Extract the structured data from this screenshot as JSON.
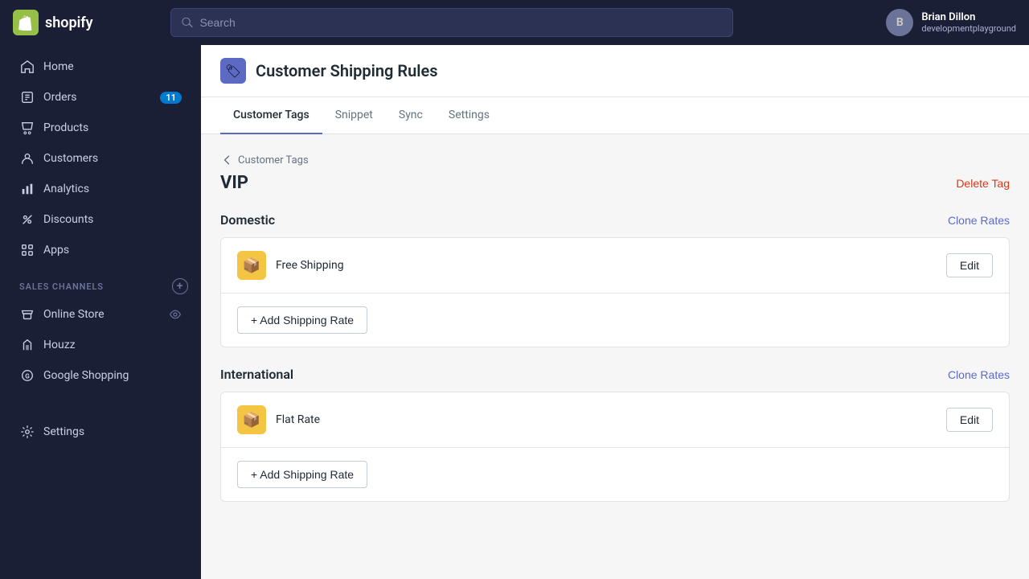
{
  "topnav": {
    "logo_text": "shopify",
    "search_placeholder": "Search"
  },
  "user": {
    "name": "Brian Dillon",
    "sub": "developmentplayground",
    "initials": "B"
  },
  "sidebar": {
    "items": [
      {
        "id": "home",
        "label": "Home",
        "icon": "home-icon",
        "badge": null
      },
      {
        "id": "orders",
        "label": "Orders",
        "icon": "orders-icon",
        "badge": "11"
      },
      {
        "id": "products",
        "label": "Products",
        "icon": "products-icon",
        "badge": null
      },
      {
        "id": "customers",
        "label": "Customers",
        "icon": "customers-icon",
        "badge": null
      },
      {
        "id": "analytics",
        "label": "Analytics",
        "icon": "analytics-icon",
        "badge": null
      },
      {
        "id": "discounts",
        "label": "Discounts",
        "icon": "discounts-icon",
        "badge": null
      },
      {
        "id": "apps",
        "label": "Apps",
        "icon": "apps-icon",
        "badge": null
      }
    ],
    "sales_channels_label": "SALES CHANNELS",
    "sales_channels": [
      {
        "id": "online-store",
        "label": "Online Store",
        "icon": "store-icon",
        "has_eye": true
      },
      {
        "id": "houzz",
        "label": "Houzz",
        "icon": "houzz-icon",
        "has_eye": false
      },
      {
        "id": "google-shopping",
        "label": "Google Shopping",
        "icon": "google-icon",
        "has_eye": false
      }
    ],
    "settings_label": "Settings"
  },
  "page": {
    "title": "Customer Shipping Rules",
    "icon": "🏷",
    "tabs": [
      {
        "id": "customer-tags",
        "label": "Customer Tags",
        "active": true
      },
      {
        "id": "snippet",
        "label": "Snippet",
        "active": false
      },
      {
        "id": "sync",
        "label": "Sync",
        "active": false
      },
      {
        "id": "settings",
        "label": "Settings",
        "active": false
      }
    ],
    "breadcrumb": "Customer Tags",
    "tag_name": "VIP",
    "delete_tag_label": "Delete Tag",
    "sections": [
      {
        "id": "domestic",
        "title": "Domestic",
        "clone_rates_label": "Clone Rates",
        "rates": [
          {
            "id": "free-shipping",
            "name": "Free Shipping",
            "icon": "📦"
          }
        ],
        "add_rate_label": "+ Add Shipping Rate"
      },
      {
        "id": "international",
        "title": "International",
        "clone_rates_label": "Clone Rates",
        "rates": [
          {
            "id": "flat-rate",
            "name": "Flat Rate",
            "icon": "📦"
          }
        ],
        "add_rate_label": "+ Add Shipping Rate"
      }
    ]
  }
}
